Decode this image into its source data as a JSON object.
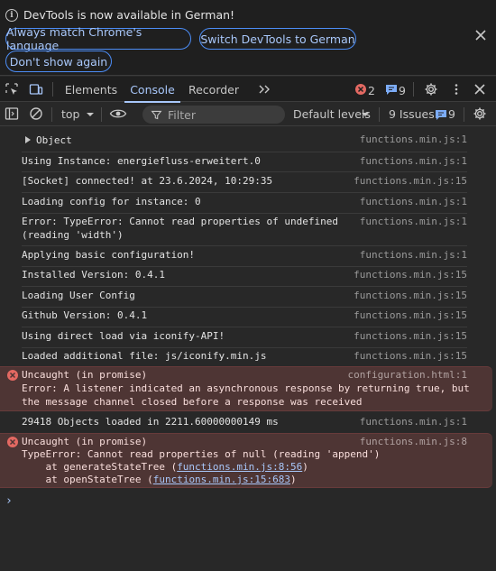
{
  "infobar": {
    "message": "DevTools is now available in German!",
    "buttons": [
      "Always match Chrome's language",
      "Switch DevTools to German",
      "Don't show again"
    ]
  },
  "tabs": {
    "items": [
      "Elements",
      "Console",
      "Recorder"
    ],
    "active": "Console",
    "error_count": "2",
    "message_count": "9"
  },
  "toolbar": {
    "context": "top",
    "filter_placeholder": "Filter",
    "levels": "Default levels",
    "issues_label": "9 Issues:",
    "issues_count": "9"
  },
  "console": {
    "messages": [
      {
        "text": "Object",
        "source": "functions.min.js:1"
      },
      {
        "text": "Using Instance: energiefluss-erweitert.0",
        "source": "functions.min.js:1"
      },
      {
        "text": "[Socket] connected! at 23.6.2024, 10:29:35",
        "source": "functions.min.js:15"
      },
      {
        "text": "Loading config for instance: 0",
        "source": "functions.min.js:1"
      },
      {
        "text": "Error: TypeError: Cannot read properties of undefined\n(reading 'width')",
        "source": "functions.min.js:1"
      },
      {
        "text": "Applying basic configuration!",
        "source": "functions.min.js:1"
      },
      {
        "text": "Installed Version: 0.4.1",
        "source": "functions.min.js:15"
      },
      {
        "text": "Loading User Config",
        "source": "functions.min.js:15"
      },
      {
        "text": "Github Version: 0.4.1",
        "source": "functions.min.js:15"
      },
      {
        "text": "Using direct load via iconify-API!",
        "source": "functions.min.js:15"
      },
      {
        "text": "Loaded additional file: js/iconify.min.js",
        "source": "functions.min.js:15"
      },
      {
        "text": "29418 Objects loaded in 2211.60000000149 ms",
        "source": "functions.min.js:1"
      }
    ],
    "errors": [
      {
        "title": "Uncaught (in promise)",
        "source": "configuration.html:1",
        "body": "Error: A listener indicated an asynchronous response by returning true, but\nthe message channel closed before a response was received"
      },
      {
        "title": "Uncaught (in promise)",
        "source": "functions.min.js:8",
        "body": "TypeError: Cannot read properties of null (reading 'append')",
        "stack": [
          {
            "prefix": "    at generateStateTree (",
            "link": "functions.min.js:8:56",
            "suffix": ")"
          },
          {
            "prefix": "    at openStateTree (",
            "link": "functions.min.js:15:683",
            "suffix": ")"
          }
        ]
      }
    ],
    "prompt": "›"
  }
}
